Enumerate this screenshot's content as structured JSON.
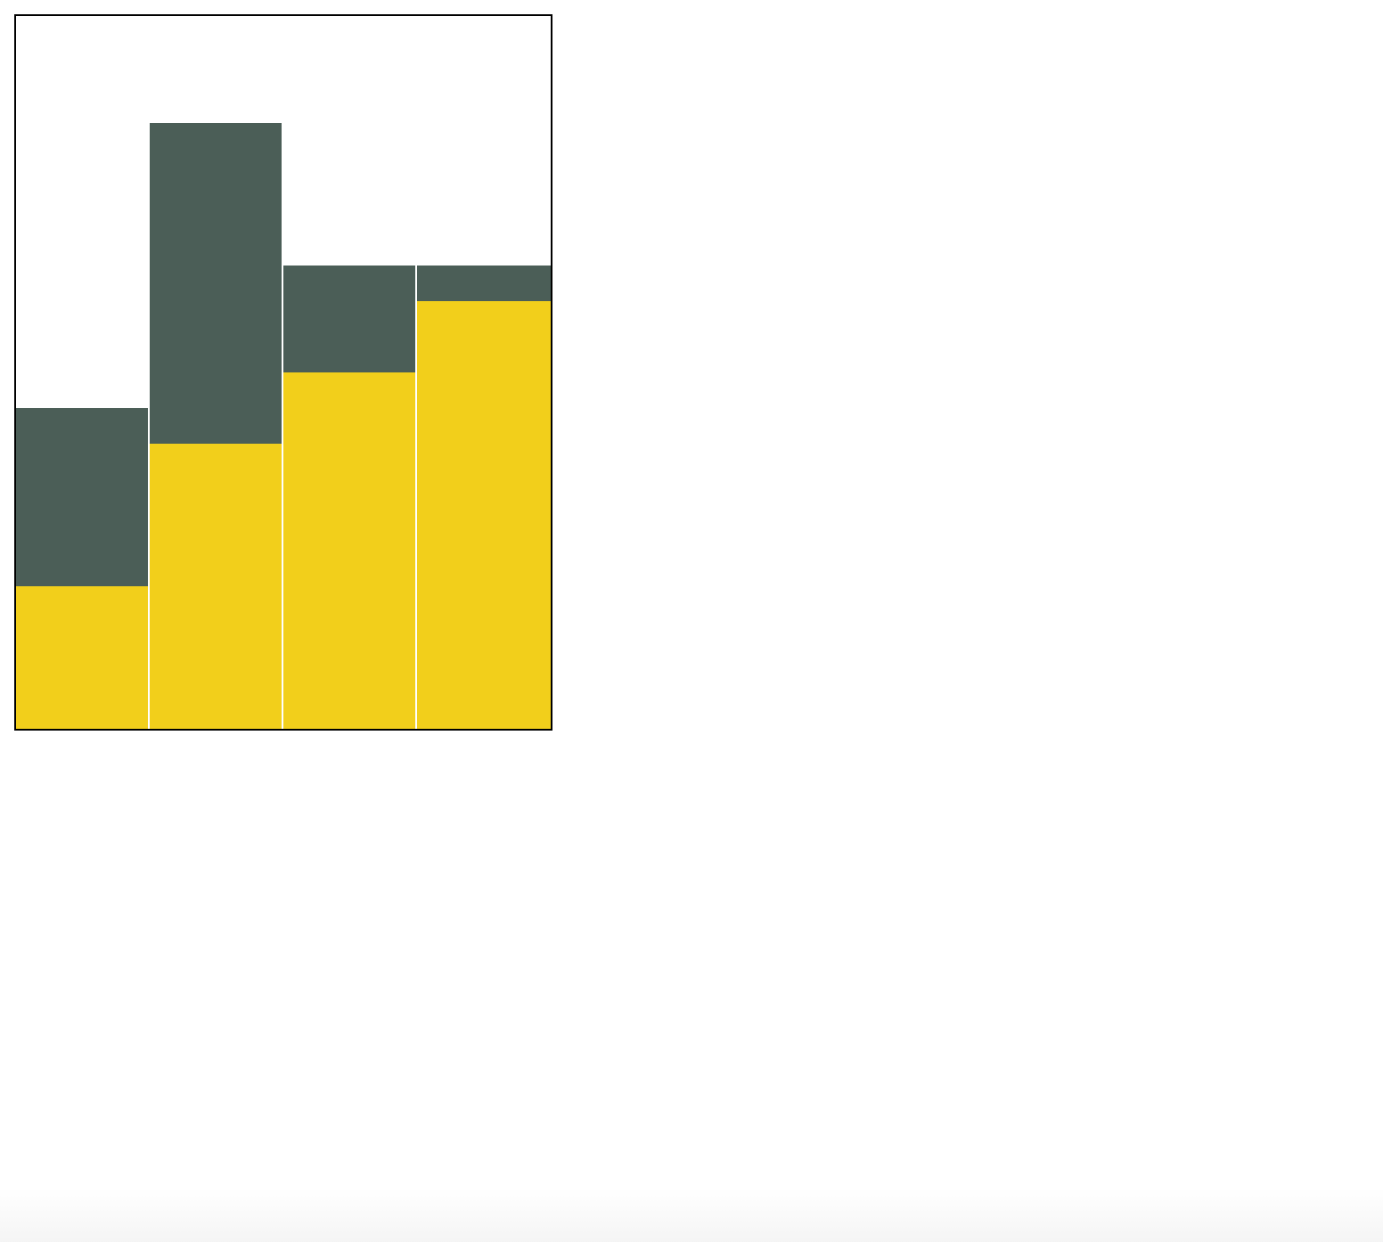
{
  "chart_data": {
    "type": "bar",
    "stacked": true,
    "categories": [
      "",
      "",
      "",
      ""
    ],
    "series": [
      {
        "values": [
          4,
          8,
          10,
          12
        ]
      },
      {
        "values": [
          5,
          9,
          3,
          1
        ]
      }
    ],
    "title": "",
    "xlabel": "",
    "ylabel": "",
    "ylim": [
      0,
      20
    ],
    "grid": false,
    "legend": "none"
  },
  "colors": {
    "series": [
      "#f2cf1b",
      "#4b5e57"
    ],
    "frame": "#000000",
    "separator": "#ffffff"
  }
}
